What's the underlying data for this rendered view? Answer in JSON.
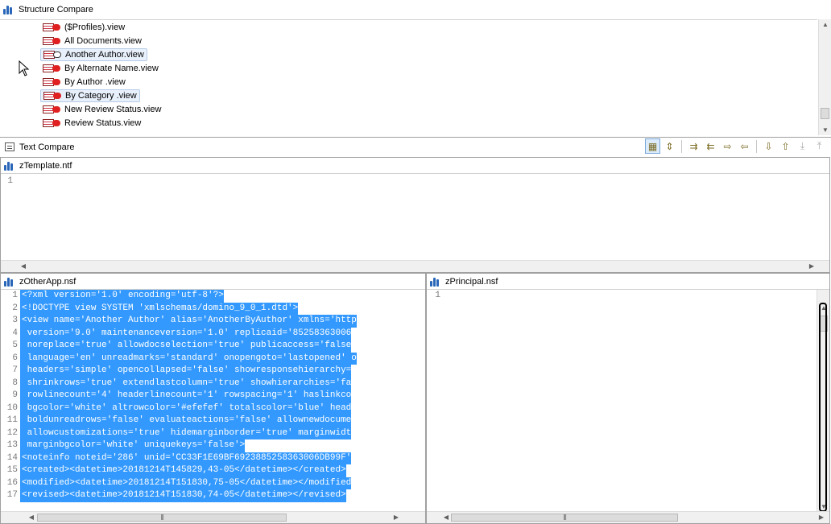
{
  "structure_compare": {
    "title": "Structure Compare",
    "items": [
      {
        "label": "($Profiles).view",
        "selected": false
      },
      {
        "label": "All Documents.view",
        "selected": false
      },
      {
        "label": "Another Author.view",
        "selected": true
      },
      {
        "label": "By Alternate Name.view",
        "selected": false
      },
      {
        "label": "By Author .view",
        "selected": false
      },
      {
        "label": "By Category .view",
        "selected": true
      },
      {
        "label": "New Review Status.view",
        "selected": false
      },
      {
        "label": "Review Status.view",
        "selected": false
      }
    ]
  },
  "text_compare": {
    "title": "Text Compare",
    "toolbar_icons": [
      "two-pane-layout-icon",
      "three-pane-layout-icon",
      "copy-all-left-to-right-icon",
      "copy-all-right-to-left-icon",
      "copy-change-left-to-right-icon",
      "copy-change-right-to-left-icon",
      "next-difference-icon",
      "previous-difference-icon",
      "next-change-icon",
      "previous-change-icon"
    ]
  },
  "ancestor_pane": {
    "title": "zTemplate.ntf",
    "lines": [
      {
        "n": "1",
        "text": ""
      }
    ]
  },
  "left_pane": {
    "title": "zOtherApp.nsf",
    "lines": [
      {
        "n": "1",
        "text": "<?xml version='1.0' encoding='utf-8'?>"
      },
      {
        "n": "2",
        "text": "<!DOCTYPE view SYSTEM 'xmlschemas/domino_9_0_1.dtd'>"
      },
      {
        "n": "3",
        "text": "<view name='Another Author' alias='AnotherByAuthor' xmlns='http"
      },
      {
        "n": "4",
        "text": " version='9.0' maintenanceversion='1.0' replicaid='85258363006"
      },
      {
        "n": "5",
        "text": " noreplace='true' allowdocselection='true' publicaccess='false"
      },
      {
        "n": "6",
        "text": " language='en' unreadmarks='standard' onopengoto='lastopened' o"
      },
      {
        "n": "7",
        "text": " headers='simple' opencollapsed='false' showresponsehierarchy="
      },
      {
        "n": "8",
        "text": " shrinkrows='true' extendlastcolumn='true' showhierarchies='fa"
      },
      {
        "n": "9",
        "text": " rowlinecount='4' headerlinecount='1' rowspacing='1' haslinkco"
      },
      {
        "n": "10",
        "text": " bgcolor='white' altrowcolor='#efefef' totalscolor='blue' head"
      },
      {
        "n": "11",
        "text": " boldunreadrows='false' evaluateactions='false' allownewdocume"
      },
      {
        "n": "12",
        "text": " allowcustomizations='true' hidemarginborder='true' marginwidt"
      },
      {
        "n": "13",
        "text": " marginbgcolor='white' uniquekeys='false'>"
      },
      {
        "n": "14",
        "text": "<noteinfo noteid='286' unid='CC33F1E69BF6923885258363006DB99F'"
      },
      {
        "n": "15",
        "text": "<created><datetime>20181214T145829,43-05</datetime></created>"
      },
      {
        "n": "16",
        "text": "<modified><datetime>20181214T151830,75-05</datetime></modified"
      },
      {
        "n": "17",
        "text": "<revised><datetime>20181214T151830,74-05</datetime></revised>"
      }
    ]
  },
  "right_pane": {
    "title": "zPrincipal.nsf",
    "lines": [
      {
        "n": "1",
        "text": ""
      }
    ]
  },
  "colors": {
    "selection": "#3399ff",
    "app_icon": "#2a66b8",
    "view_icon_dot": "#e02020"
  }
}
